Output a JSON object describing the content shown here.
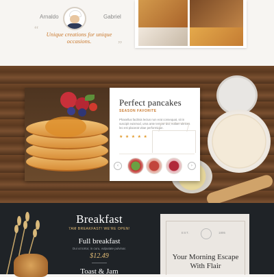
{
  "chef_section": {
    "chef_left": "Arnaldo",
    "chef_right": "Gabriel",
    "tagline": "Unique creations for unique occasions."
  },
  "featured_card": {
    "title": "Perfect pancakes",
    "subtitle": "SEASON FAVORITE",
    "description": "Phasellus facilisis lectus non erat consequat, sit in suscipit euismod, uma ante tempor dui, nullam ultrices leo est placerat vitae performique.",
    "rating_stars": "★ ★ ★ ★ ★",
    "nav_prev": "‹",
    "nav_next": "›"
  },
  "breakfast_section": {
    "title": "Breakfast",
    "hours": "7AM BREAKFAST! WE'RE OPEN!",
    "item1_name": "Full breakfast",
    "item1_desc": "Dui ut tortor, in curu, vulputate pulvinar.",
    "item1_price": "$12.49",
    "item2_name": "Toast & Jam"
  },
  "poster": {
    "est_label": "EST.",
    "year": "1895",
    "title": "Your Morning Escape With Flair"
  },
  "colors": {
    "accent": "#c9792e",
    "dark_bg": "#1f2327",
    "gold": "#e9c178"
  }
}
